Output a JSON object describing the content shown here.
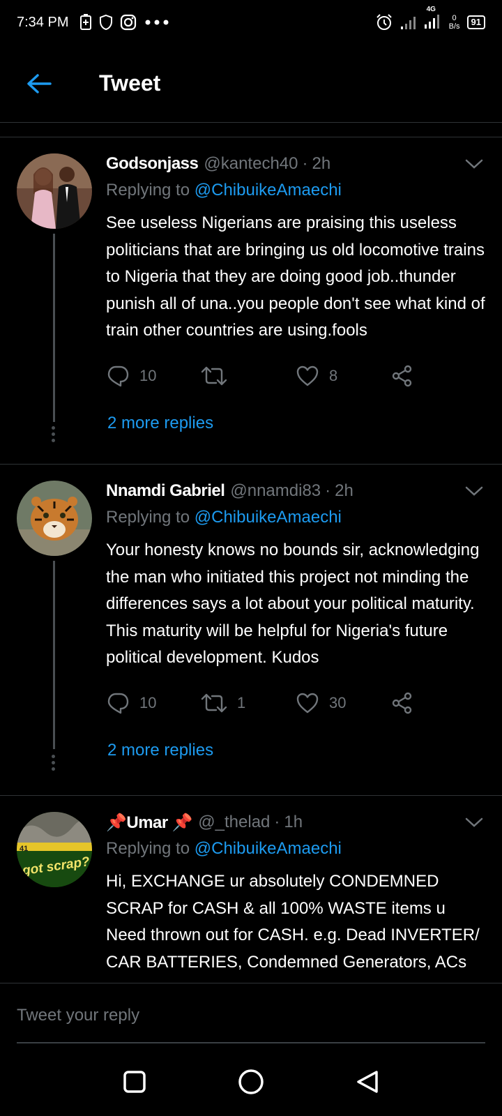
{
  "status_bar": {
    "time": "7:34 PM",
    "net_speed_value": "0",
    "net_speed_unit": "B/s",
    "battery": "91",
    "network": "4G",
    "icons": [
      "battery-saver-icon",
      "shield-icon",
      "instagram-icon",
      "more-dots-icon",
      "alarm-icon",
      "signal-icon",
      "signal-icon"
    ]
  },
  "header": {
    "title": "Tweet",
    "back_icon": "arrow-left-icon"
  },
  "tweets": [
    {
      "name": "Godsonjass",
      "handle": "@kantech40",
      "separator": "·",
      "time": "2h",
      "replying_prefix": "Replying to",
      "replying_to": "@ChibuikeAmaechi",
      "text": "See useless Nigerians are praising this useless politicians that are bringing us old locomotive trains to Nigeria that they are doing good job..thunder punish all of una..you people don't see what kind of train other countries are using.fools",
      "replies": "10",
      "retweets": "",
      "likes": "8",
      "more_replies": "2 more replies"
    },
    {
      "name": "Nnamdi Gabriel",
      "handle": "@nnamdi83",
      "separator": "·",
      "time": "2h",
      "replying_prefix": "Replying to",
      "replying_to": "@ChibuikeAmaechi",
      "text": "Your honesty knows no bounds sir, acknowledging the man who initiated this project not minding the differences says a lot about your political maturity. This maturity will be helpful for Nigeria's future political development. Kudos",
      "replies": "10",
      "retweets": "1",
      "likes": "30",
      "more_replies": "2 more replies"
    },
    {
      "name": "📌Umar 📌",
      "handle": "@_thelad",
      "separator": "·",
      "time": "1h",
      "replying_prefix": "Replying to",
      "replying_to": "@ChibuikeAmaechi",
      "avatar_text": "got scrap?",
      "avatar_digits": "41",
      "text": "Hi, EXCHANGE ur absolutely CONDEMNED SCRAP for CASH & all 100% WASTE items u Need thrown out for CASH. e.g. Dead INVERTER/ CAR BATTERIES, Condemned Generators, ACs"
    }
  ],
  "composer": {
    "placeholder": "Tweet your reply"
  },
  "nav": {
    "recents": "square-icon",
    "home": "circle-icon",
    "back": "triangle-back-icon"
  },
  "colors": {
    "background": "#000000",
    "accent": "#1d9bf0",
    "secondary_text": "#71767b",
    "divider": "#2f3336"
  }
}
